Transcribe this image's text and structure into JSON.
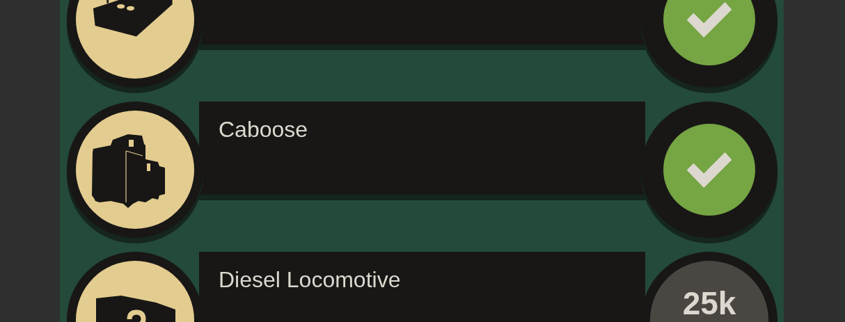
{
  "rows": [
    {
      "unlocked": true
    },
    {
      "name": "Caboose",
      "unlocked": true
    },
    {
      "name": "Diesel Locomotive",
      "unlocked": false,
      "price": "25k"
    }
  ]
}
